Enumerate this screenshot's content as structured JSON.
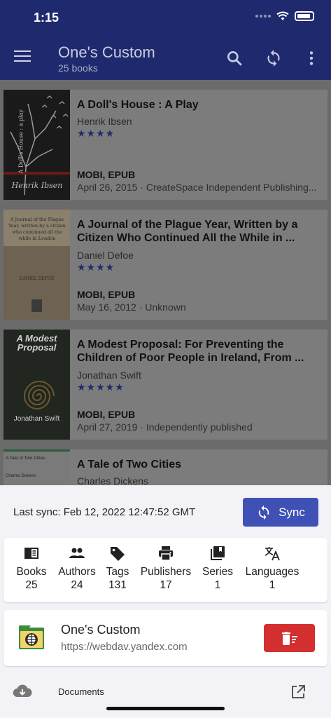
{
  "status_bar": {
    "time": "1:15"
  },
  "app_bar": {
    "title": "One's Custom",
    "subtitle": "25 books"
  },
  "books": [
    {
      "title": "A Doll's House : A Play",
      "author": "Henrik Ibsen",
      "rating": "★★★★",
      "formats": "MOBI, EPUB",
      "meta": "April 26, 2015 · CreateSpace Independent Publishing...",
      "cover_title": "A Doll's House : a play",
      "cover_author": "Henrik Ibsen"
    },
    {
      "title": "A Journal of the Plague Year, Written by a Citizen Who Continued All the While in ...",
      "author": "Daniel Defoe",
      "rating": "★★★★",
      "formats": "MOBI, EPUB",
      "meta": "May 16, 2012 · Unknown",
      "cover_title": "A Journal of the Plague Year, written by a citizen who continued all the while in London",
      "cover_author": "DANIEL DEFOE"
    },
    {
      "title": "A Modest Proposal: For Preventing the Children of Poor People in Ireland, From ...",
      "author": "Jonathan Swift",
      "rating": "★★★★★",
      "formats": "MOBI, EPUB",
      "meta": "April 27, 2019 · Independently published",
      "cover_title": "A Modest Proposal",
      "cover_author": "Jonathan Swift"
    },
    {
      "title": "A Tale of Two Cities",
      "author": "Charles Dickens",
      "rating": "★★★★",
      "cover_title": "A Tale of Two Cities",
      "cover_author": "Charles Dickens"
    }
  ],
  "sync": {
    "last_sync": "Last sync: Feb 12, 2022 12:47:52 GMT",
    "button_label": "Sync",
    "accent": "#3f51b5"
  },
  "stats": [
    {
      "label": "Books",
      "count": "25",
      "icon": "book-icon"
    },
    {
      "label": "Authors",
      "count": "24",
      "icon": "people-icon"
    },
    {
      "label": "Tags",
      "count": "131",
      "icon": "tag-icon"
    },
    {
      "label": "Publishers",
      "count": "17",
      "icon": "printer-icon"
    },
    {
      "label": "Series",
      "count": "1",
      "icon": "library-icon"
    },
    {
      "label": "Languages",
      "count": "1",
      "icon": "translate-icon"
    }
  ],
  "library": {
    "name": "One's Custom",
    "url": "https://webdav.yandex.com",
    "delete_color": "#d32f2f"
  },
  "documents": {
    "label": "Documents"
  }
}
